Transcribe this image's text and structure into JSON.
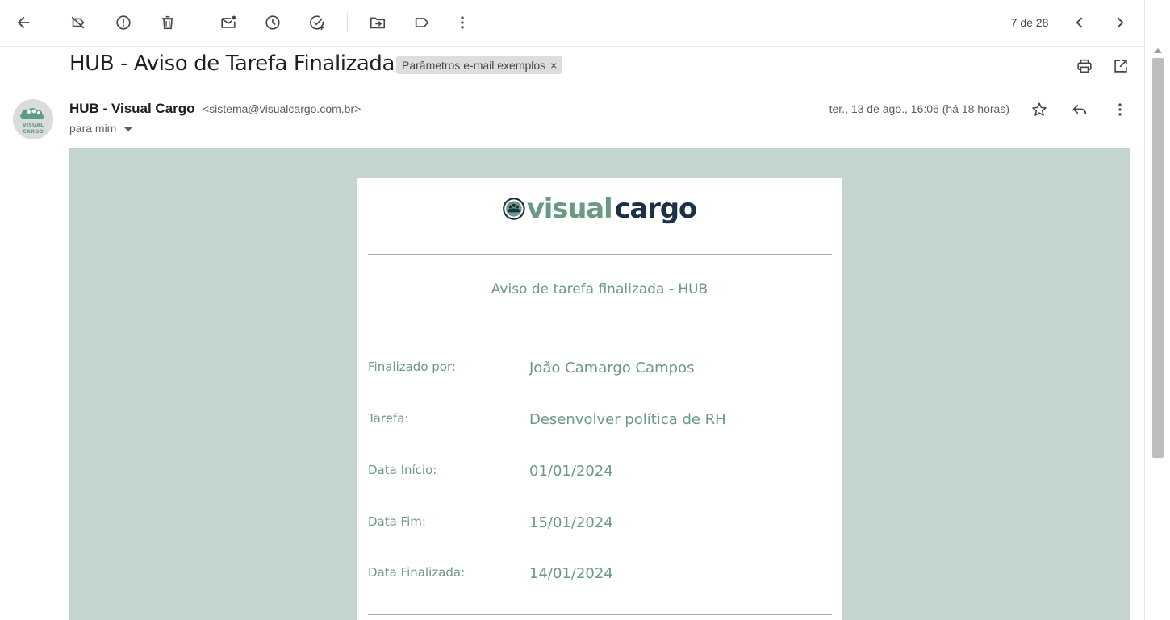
{
  "toolbar": {
    "page_count": "7 de 28"
  },
  "email": {
    "subject": "HUB - Aviso de Tarefa Finalizada",
    "label": "Parâmetros e-mail exemplos",
    "label_remove": "×",
    "sender_name": "HUB - Visual Cargo",
    "sender_email": "<sistema@visualcargo.com.br>",
    "recipient": "para mim",
    "date": "ter., 13 de ago., 16:06 (há 18 horas)",
    "avatar_text_1": "VISUAL",
    "avatar_text_2": "CARGO"
  },
  "body": {
    "logo_word_1": "visual",
    "logo_word_2": "cargo",
    "notice_title": "Aviso de tarefa finalizada - HUB",
    "rows": [
      {
        "label": "Finalizado por:",
        "value": "João Camargo Campos"
      },
      {
        "label": "Tarefa:",
        "value": "Desenvolver política de RH"
      },
      {
        "label": "Data Início:",
        "value": "01/01/2024"
      },
      {
        "label": "Data Fim:",
        "value": "15/01/2024"
      },
      {
        "label": "Data Finalizada:",
        "value": "14/01/2024"
      }
    ]
  },
  "colors": {
    "brand_green": "#6b9a82",
    "brand_navy": "#1c3147",
    "body_background": "#c4d5cf"
  }
}
